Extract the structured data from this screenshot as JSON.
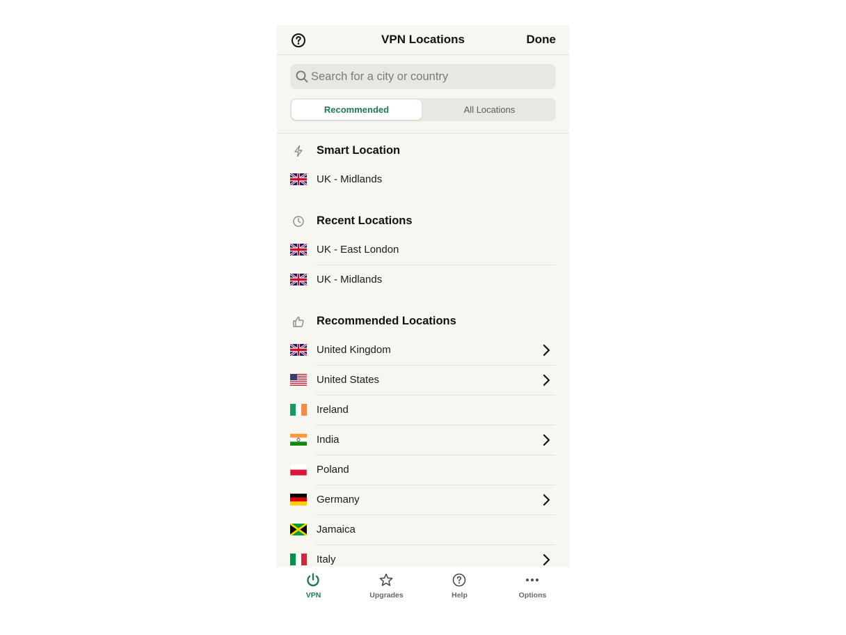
{
  "header": {
    "title": "VPN Locations",
    "done_label": "Done",
    "help_icon": "question-circle-icon"
  },
  "search": {
    "placeholder": "Search for a city or country",
    "value": ""
  },
  "segment": {
    "options": [
      "Recommended",
      "All Locations"
    ],
    "selected": "Recommended",
    "accent": "#1b7a55"
  },
  "sections": {
    "smart": {
      "title": "Smart Location",
      "icon": "bolt-icon",
      "items": [
        {
          "label": "UK - Midlands",
          "flag": "gb",
          "chevron": false
        }
      ]
    },
    "recent": {
      "title": "Recent Locations",
      "icon": "clock-icon",
      "items": [
        {
          "label": "UK - East London",
          "flag": "gb",
          "chevron": false
        },
        {
          "label": "UK - Midlands",
          "flag": "gb",
          "chevron": false
        }
      ]
    },
    "recommended": {
      "title": "Recommended Locations",
      "icon": "thumbs-up-icon",
      "items": [
        {
          "label": "United Kingdom",
          "flag": "gb",
          "chevron": true
        },
        {
          "label": "United States",
          "flag": "us",
          "chevron": true
        },
        {
          "label": "Ireland",
          "flag": "ie",
          "chevron": false
        },
        {
          "label": "India",
          "flag": "in",
          "chevron": true
        },
        {
          "label": "Poland",
          "flag": "pl",
          "chevron": false
        },
        {
          "label": "Germany",
          "flag": "de",
          "chevron": true
        },
        {
          "label": "Jamaica",
          "flag": "jm",
          "chevron": false
        },
        {
          "label": "Italy",
          "flag": "it",
          "chevron": true
        }
      ]
    }
  },
  "tabbar": {
    "active": "VPN",
    "tabs": [
      {
        "label": "VPN",
        "icon": "power-icon"
      },
      {
        "label": "Upgrades",
        "icon": "star-icon"
      },
      {
        "label": "Help",
        "icon": "question-circle-icon"
      },
      {
        "label": "Options",
        "icon": "ellipsis-icon"
      }
    ]
  }
}
